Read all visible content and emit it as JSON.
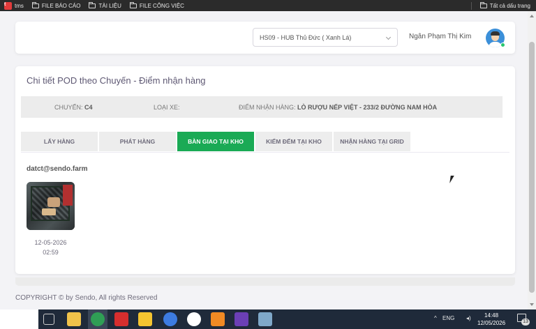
{
  "bookmarks": {
    "items": [
      {
        "label": "tms",
        "icon": "tms-logo-icon"
      },
      {
        "label": "FILE BÁO CÁO",
        "icon": "folder-icon"
      },
      {
        "label": "TÀI LIỆU",
        "icon": "folder-icon"
      },
      {
        "label": "FILE CÔNG VIỆC",
        "icon": "folder-icon"
      }
    ],
    "all_bookmarks": "Tất cả dấu trang"
  },
  "header": {
    "hub_select": "HS09 - HUB Thủ Đức ( Xanh Lá)",
    "user_name": "Ngân Phạm Thị Kim"
  },
  "main": {
    "title": "Chi tiết POD theo Chuyến - Điểm nhận hàng",
    "info": {
      "trip_label": "CHUYẾN:",
      "trip_value": "C4",
      "vehicle_label": "LOẠI XE:",
      "vehicle_value": "",
      "pickup_label": "ĐIỂM NHẬN HÀNG:",
      "pickup_value": "LÒ RƯỢU NẾP VIỆT - 233/2 ĐƯỜNG NAM HÒA"
    },
    "tabs": [
      {
        "label": "LẤY HÀNG",
        "active": false
      },
      {
        "label": "PHÁT HÀNG",
        "active": false
      },
      {
        "label": "BÀN GIAO TẠI KHO",
        "active": true
      },
      {
        "label": "KIỂM ĐẾM TẠI KHO",
        "active": false
      },
      {
        "label": "NHẬN HÀNG TẠI GRID",
        "active": false
      }
    ],
    "email": "datct@sendo.farm",
    "photo_date": "12-05-2026",
    "photo_time": "02:59"
  },
  "footer": "COPYRIGHT © by Sendo, All rights Reserved",
  "taskbar": {
    "wifi_text": "ENG",
    "time": "14:48",
    "date": "12/05/2026",
    "notification_count": "13"
  },
  "colors": {
    "accent": "#1aaa55",
    "online": "#28c76f"
  }
}
